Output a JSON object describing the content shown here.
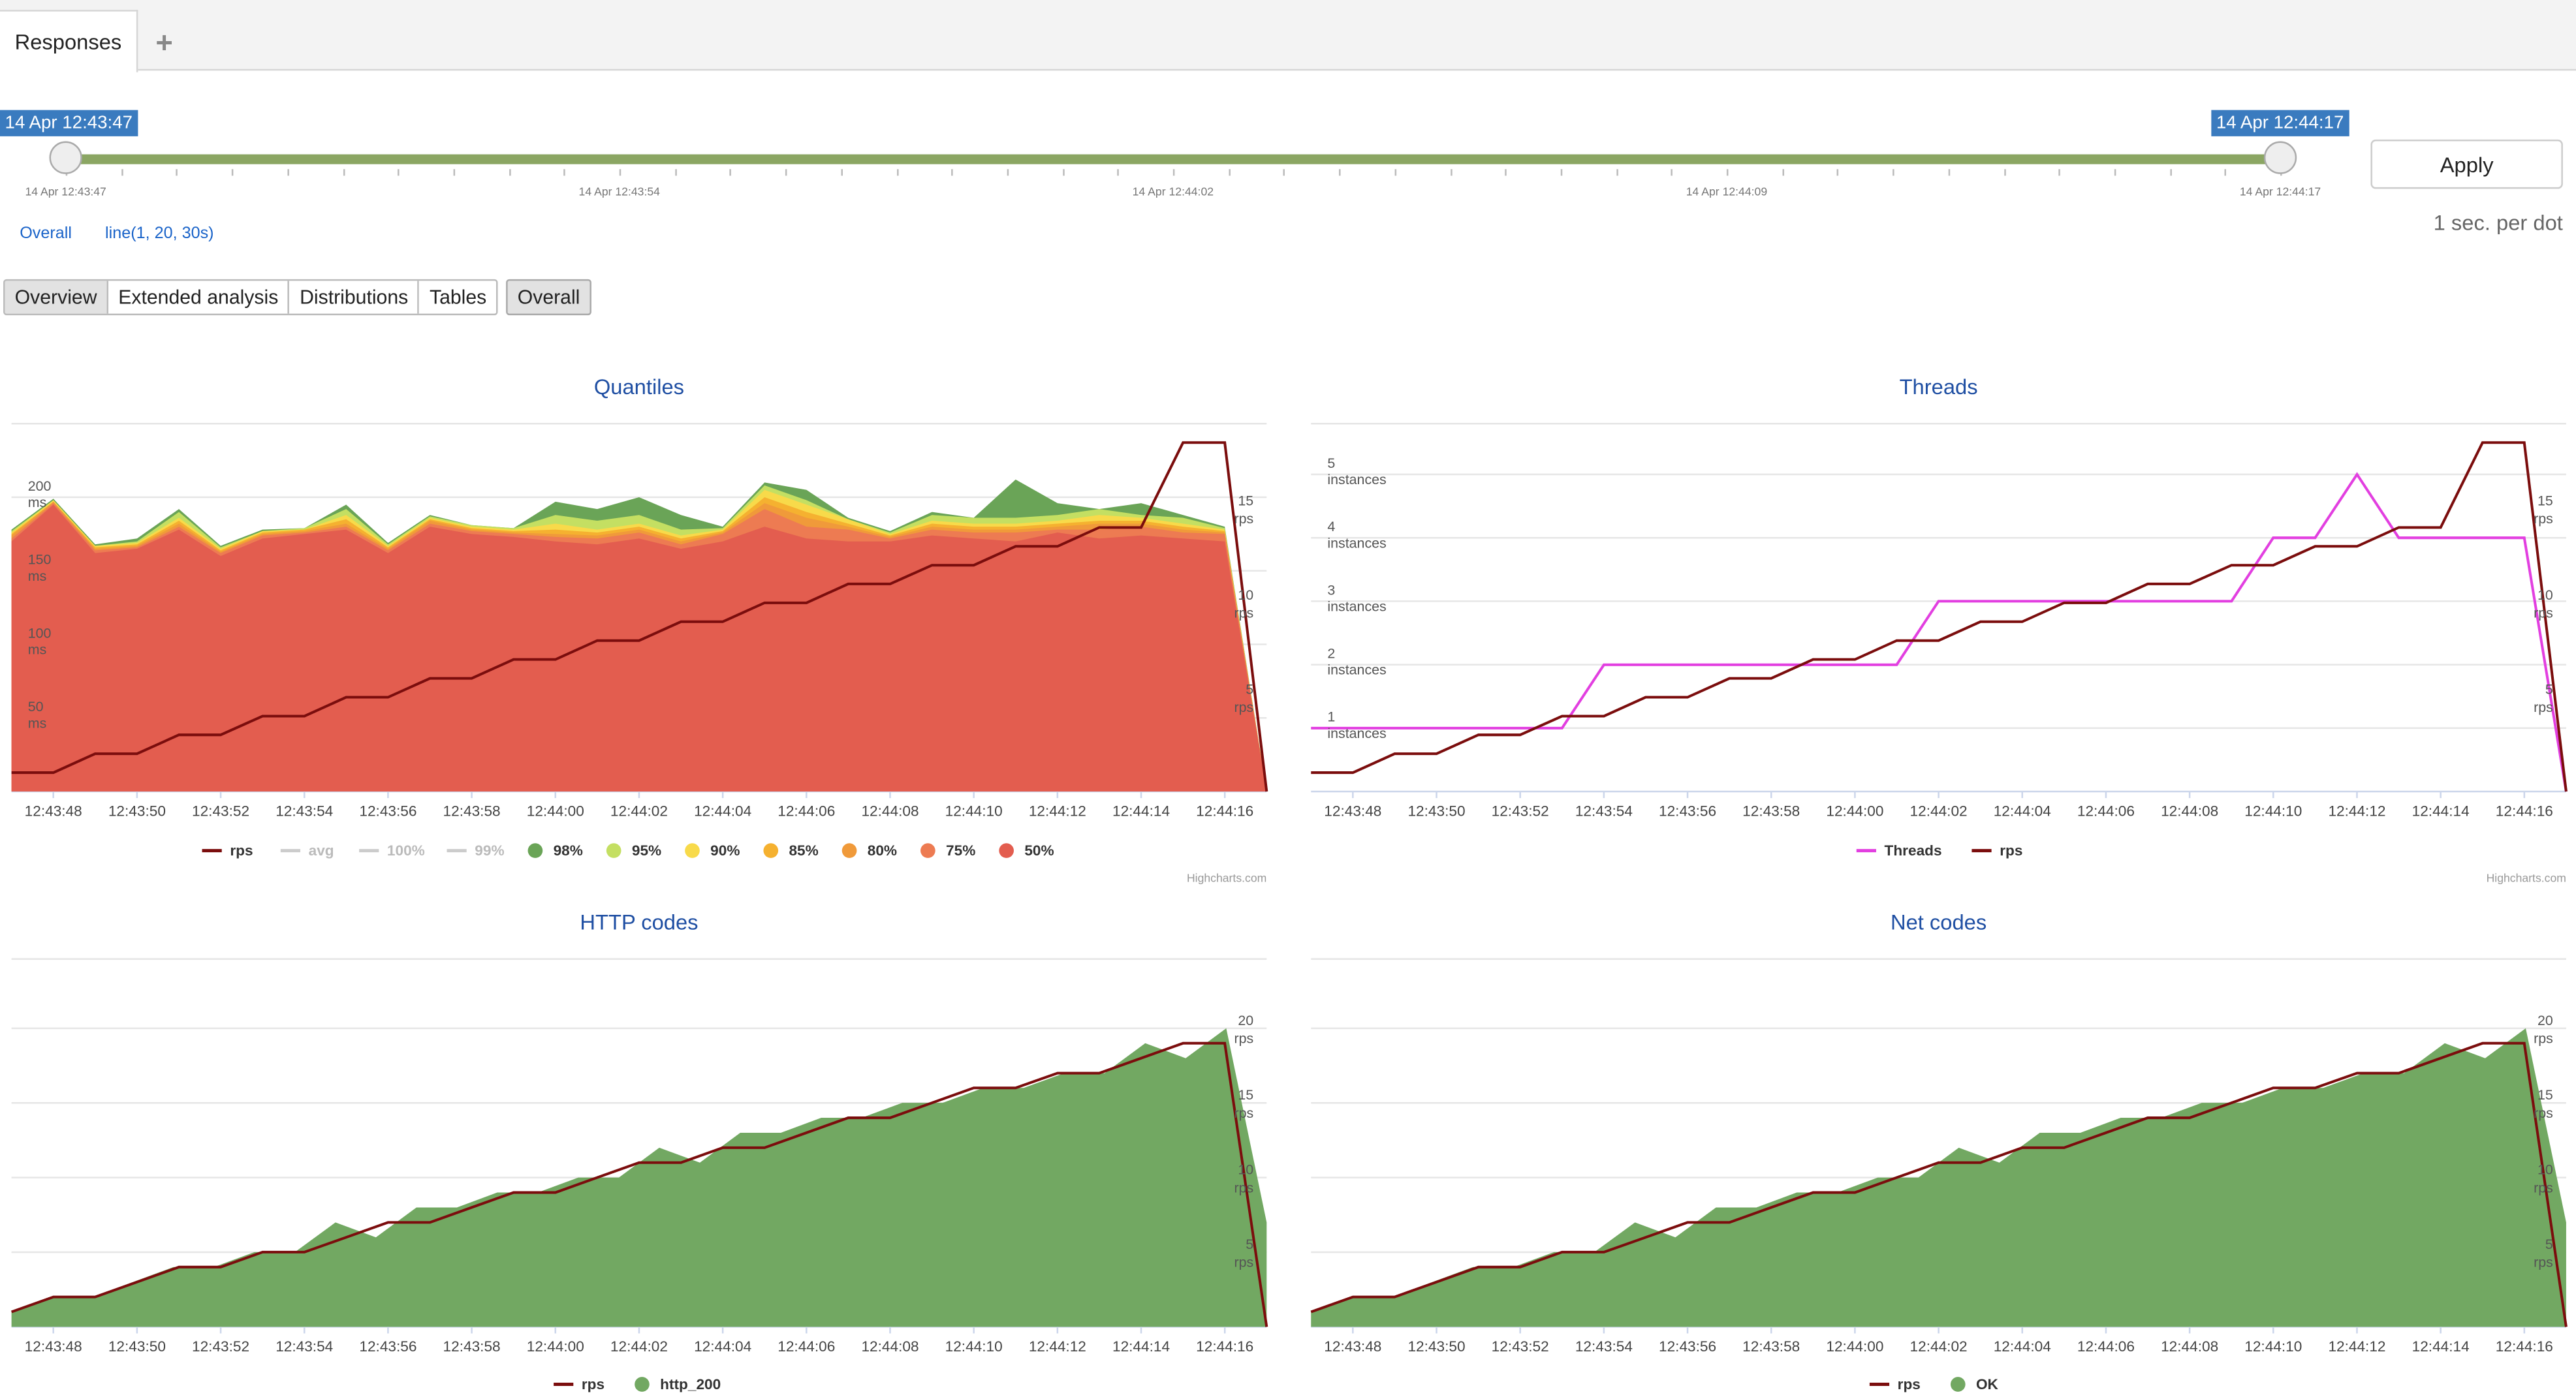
{
  "tabs": {
    "active": "Responses",
    "add_icon": "plus-icon"
  },
  "timeline": {
    "start_badge": "14 Apr 12:43:47",
    "end_badge": "14 Apr 12:44:17",
    "tick_labels": [
      "14 Apr 12:43:47",
      "14 Apr 12:43:54",
      "14 Apr 12:44:02",
      "14 Apr 12:44:09",
      "14 Apr 12:44:17"
    ],
    "apply_label": "Apply",
    "per_dot": "1 sec. per dot"
  },
  "filters": {
    "overall": "Overall",
    "line": "line(1, 20, 30s)"
  },
  "view_tabs": [
    {
      "label": "Overview",
      "selected": true
    },
    {
      "label": "Extended analysis",
      "selected": false
    },
    {
      "label": "Distributions",
      "selected": false
    },
    {
      "label": "Tables",
      "selected": false
    }
  ],
  "overall_button": "Overall",
  "colors": {
    "rps": "#7b0d0d",
    "threads": "#e23fe0",
    "q50": "#e35d4f",
    "q75": "#ed7b52",
    "q80": "#f09a3a",
    "q85": "#f5b130",
    "q90": "#f8da4a",
    "q95": "#c4df62",
    "q98": "#6aa457",
    "http200": "#72a862",
    "accent": "#3a7bbf"
  },
  "x_labels": [
    "12:43:48",
    "12:43:50",
    "12:43:52",
    "12:43:54",
    "12:43:56",
    "12:43:58",
    "12:44:00",
    "12:44:02",
    "12:44:04",
    "12:44:06",
    "12:44:08",
    "12:44:10",
    "12:44:12",
    "12:44:14",
    "12:44:16"
  ],
  "highcharts_credit": "Highcharts.com",
  "chart_data": [
    {
      "id": "quantiles",
      "type": "area",
      "title": "Quantiles",
      "y_left": {
        "ticks": [
          {
            "v": 50,
            "t": "50",
            "u": "ms"
          },
          {
            "v": 100,
            "t": "100",
            "u": "ms"
          },
          {
            "v": 150,
            "t": "150",
            "u": "ms"
          },
          {
            "v": 200,
            "t": "200",
            "u": "ms"
          }
        ],
        "ylim": [
          0,
          250
        ]
      },
      "y_right": {
        "ticks": [
          {
            "v": 5,
            "t": "5",
            "u": "rps"
          },
          {
            "v": 10,
            "t": "10",
            "u": "rps"
          },
          {
            "v": 15,
            "t": "15",
            "u": "rps"
          }
        ],
        "ylim": [
          0,
          19.5
        ]
      },
      "x_start": "12:43:47",
      "x_end": "12:44:17",
      "series": [
        {
          "name": "50%",
          "color_key": "q50",
          "values": [
            170,
            195,
            162,
            165,
            178,
            160,
            172,
            175,
            178,
            162,
            180,
            175,
            173,
            170,
            168,
            172,
            165,
            170,
            180,
            172,
            170,
            170,
            174,
            172,
            170,
            176,
            172,
            174,
            172,
            170,
            0
          ]
        },
        {
          "name": "75%",
          "color_key": "q75",
          "values": [
            172,
            196,
            164,
            166,
            180,
            162,
            174,
            176,
            180,
            164,
            182,
            177,
            175,
            173,
            172,
            176,
            168,
            175,
            192,
            180,
            178,
            172,
            178,
            176,
            176,
            178,
            178,
            180,
            176,
            175,
            0
          ]
        },
        {
          "name": "80%",
          "color_key": "q80",
          "values": [
            174,
            197,
            165,
            167,
            182,
            163,
            175,
            177,
            182,
            165,
            184,
            178,
            176,
            175,
            174,
            178,
            170,
            176,
            196,
            186,
            180,
            173,
            180,
            178,
            178,
            180,
            182,
            182,
            178,
            176,
            0
          ]
        },
        {
          "name": "85%",
          "color_key": "q85",
          "values": [
            175,
            197,
            166,
            168,
            184,
            164,
            176,
            178,
            185,
            166,
            185,
            179,
            177,
            178,
            176,
            180,
            172,
            177,
            200,
            190,
            182,
            174,
            182,
            180,
            180,
            182,
            184,
            184,
            180,
            177,
            0
          ]
        },
        {
          "name": "90%",
          "color_key": "q90",
          "values": [
            176,
            198,
            167,
            169,
            186,
            165,
            177,
            178,
            188,
            167,
            186,
            180,
            178,
            182,
            178,
            182,
            174,
            178,
            205,
            195,
            185,
            175,
            184,
            182,
            182,
            184,
            188,
            186,
            182,
            178,
            0
          ]
        },
        {
          "name": "95%",
          "color_key": "q95",
          "values": [
            177,
            198,
            167,
            170,
            190,
            166,
            177,
            179,
            192,
            168,
            187,
            181,
            179,
            188,
            184,
            188,
            178,
            179,
            208,
            198,
            185,
            176,
            188,
            186,
            186,
            188,
            192,
            188,
            186,
            179,
            0
          ]
        },
        {
          "name": "98%",
          "color_key": "q98",
          "values": [
            178,
            199,
            168,
            172,
            192,
            167,
            178,
            179,
            195,
            169,
            188,
            181,
            179,
            197,
            192,
            200,
            188,
            180,
            210,
            205,
            186,
            177,
            190,
            186,
            212,
            196,
            192,
            196,
            188,
            180,
            0
          ]
        }
      ],
      "hidden_series": [
        "avg",
        "100%",
        "99%"
      ],
      "rps": {
        "name": "rps",
        "x_index": [
          0,
          1,
          2,
          3,
          4,
          5,
          6,
          7,
          8,
          9,
          10,
          11,
          12,
          13,
          14,
          15,
          16,
          17,
          18,
          19,
          20,
          21,
          22,
          23,
          24,
          25,
          26,
          27,
          28,
          29,
          30
        ],
        "values": [
          1,
          1,
          2,
          2,
          3,
          3,
          4,
          4,
          5,
          5,
          6,
          6,
          7,
          7,
          8,
          8,
          9,
          9,
          10,
          10,
          11,
          11,
          12,
          12,
          13,
          13,
          14,
          14,
          18.5,
          18.5,
          0
        ]
      },
      "legend": [
        "rps",
        "avg",
        "100%",
        "99%",
        "98%",
        "95%",
        "90%",
        "85%",
        "80%",
        "75%",
        "50%"
      ]
    },
    {
      "id": "threads",
      "type": "line",
      "title": "Threads",
      "y_left": {
        "ticks": [
          {
            "v": 1,
            "t": "1",
            "u": "instances"
          },
          {
            "v": 2,
            "t": "2",
            "u": "instances"
          },
          {
            "v": 3,
            "t": "3",
            "u": "instances"
          },
          {
            "v": 4,
            "t": "4",
            "u": "instances"
          },
          {
            "v": 5,
            "t": "5",
            "u": "instances"
          }
        ],
        "ylim": [
          0,
          5.8
        ]
      },
      "y_right": {
        "ticks": [
          {
            "v": 5,
            "t": "5",
            "u": "rps"
          },
          {
            "v": 10,
            "t": "10",
            "u": "rps"
          },
          {
            "v": 15,
            "t": "15",
            "u": "rps"
          }
        ],
        "ylim": [
          0,
          19.5
        ]
      },
      "series": [
        {
          "name": "Threads",
          "color_key": "threads",
          "values": [
            1,
            1,
            1,
            1,
            1,
            1,
            1,
            2,
            2,
            2,
            2,
            2,
            2,
            2,
            2,
            3,
            3,
            3,
            3,
            3,
            3,
            3,
            3,
            4,
            4,
            5,
            4,
            4,
            4,
            4,
            0
          ]
        }
      ],
      "rps": {
        "name": "rps",
        "values": [
          1,
          1,
          2,
          2,
          3,
          3,
          4,
          4,
          5,
          5,
          6,
          6,
          7,
          7,
          8,
          8,
          9,
          9,
          10,
          10,
          11,
          11,
          12,
          12,
          13,
          13,
          14,
          14,
          18.5,
          18.5,
          0
        ]
      },
      "legend": [
        "Threads",
        "rps"
      ]
    },
    {
      "id": "http",
      "type": "area",
      "title": "HTTP codes",
      "y_right": {
        "ticks": [
          {
            "v": 5,
            "t": "5",
            "u": "rps"
          },
          {
            "v": 10,
            "t": "10",
            "u": "rps"
          },
          {
            "v": 15,
            "t": "15",
            "u": "rps"
          },
          {
            "v": 20,
            "t": "20",
            "u": "rps"
          }
        ],
        "ylim": [
          0,
          22
        ]
      },
      "series": [
        {
          "name": "http_200",
          "color_key": "http200",
          "values": [
            1,
            2,
            2,
            3,
            4,
            4,
            5,
            5,
            7,
            6,
            8,
            8,
            9,
            9,
            10,
            10,
            12,
            11,
            13,
            13,
            14,
            14,
            15,
            15,
            16,
            16,
            17,
            17,
            19,
            18,
            20,
            7
          ]
        }
      ],
      "rps": {
        "name": "rps",
        "values": [
          1,
          2,
          2,
          3,
          4,
          4,
          5,
          5,
          6,
          7,
          7,
          8,
          9,
          9,
          10,
          11,
          11,
          12,
          12,
          13,
          14,
          14,
          15,
          16,
          16,
          17,
          17,
          18,
          19,
          19,
          0
        ]
      },
      "legend": [
        "rps",
        "http_200"
      ]
    },
    {
      "id": "net",
      "type": "area",
      "title": "Net codes",
      "y_right": {
        "ticks": [
          {
            "v": 5,
            "t": "5",
            "u": "rps"
          },
          {
            "v": 10,
            "t": "10",
            "u": "rps"
          },
          {
            "v": 15,
            "t": "15",
            "u": "rps"
          },
          {
            "v": 20,
            "t": "20",
            "u": "rps"
          }
        ],
        "ylim": [
          0,
          22
        ]
      },
      "series": [
        {
          "name": "OK",
          "color_key": "http200",
          "values": [
            1,
            2,
            2,
            3,
            4,
            4,
            5,
            5,
            7,
            6,
            8,
            8,
            9,
            9,
            10,
            10,
            12,
            11,
            13,
            13,
            14,
            14,
            15,
            15,
            16,
            16,
            17,
            17,
            19,
            18,
            20,
            7
          ]
        }
      ],
      "rps": {
        "name": "rps",
        "values": [
          1,
          2,
          2,
          3,
          4,
          4,
          5,
          5,
          6,
          7,
          7,
          8,
          9,
          9,
          10,
          11,
          11,
          12,
          12,
          13,
          14,
          14,
          15,
          16,
          16,
          17,
          17,
          18,
          19,
          19,
          0
        ]
      },
      "legend": [
        "rps",
        "OK"
      ]
    }
  ]
}
